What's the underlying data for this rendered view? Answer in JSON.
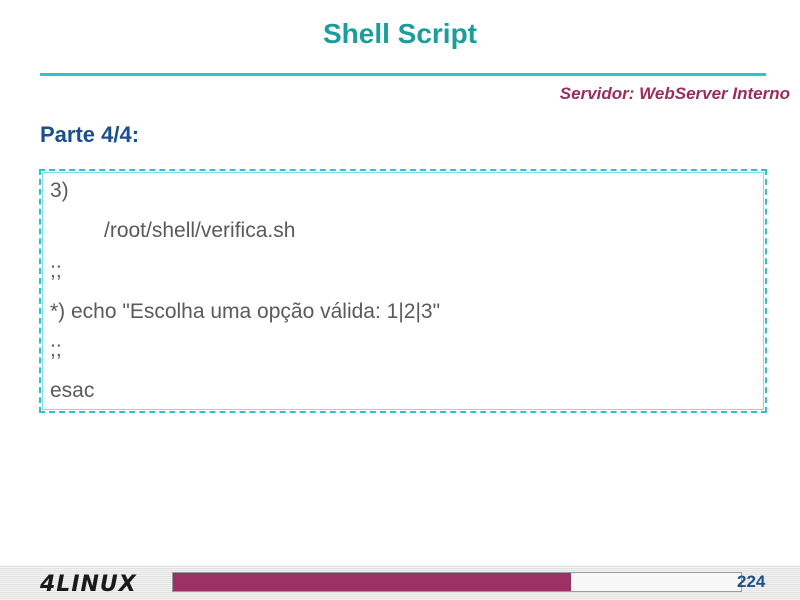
{
  "slide": {
    "title": "Shell Script",
    "subtitle": "Servidor: WebServer Interno",
    "section": "Parte 4/4:"
  },
  "code": {
    "lines": [
      "3)",
      "/root/shell/verifica.sh",
      ";;",
      "*) echo \"Escolha uma opção válida: 1|2|3\"",
      ";;",
      "esac"
    ]
  },
  "footer": {
    "logo_text": "4LINUX",
    "page_number": "224",
    "progress_fraction": 0.7
  },
  "colors": {
    "title": "#1a9e9c",
    "rule": "#2ec2cc",
    "subtitle": "#9b2d5e",
    "section": "#1b4f8a",
    "progress": "#9b3164"
  }
}
